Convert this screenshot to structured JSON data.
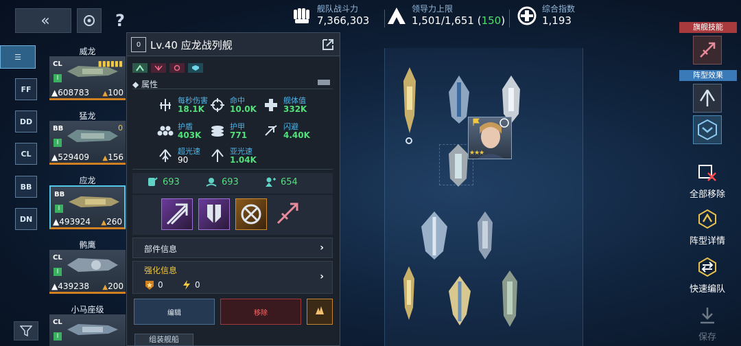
{
  "header": {
    "back_label": "«",
    "help_label": "?",
    "stats": [
      {
        "label": "舰队战斗力",
        "value": "7,366,303",
        "icon": "fist-icon"
      },
      {
        "label": "领导力上限",
        "value_main": "1,501/1,651 (",
        "value_green": "150",
        "value_end": ")",
        "icon": "leadership-icon"
      },
      {
        "label": "综合指数",
        "value": "1,193",
        "icon": "index-icon"
      }
    ]
  },
  "class_filters": [
    {
      "label": "☰",
      "active": true
    },
    {
      "label": "FF",
      "active": false
    },
    {
      "label": "DD",
      "active": false
    },
    {
      "label": "CL",
      "active": false
    },
    {
      "label": "BB",
      "active": false
    },
    {
      "label": "DN",
      "active": false
    }
  ],
  "ships": [
    {
      "name": "威龙",
      "class": "CL",
      "tier": "I",
      "power": "608783",
      "lead": "100",
      "extra": "▮▮▮▮▮▮"
    },
    {
      "name": "猛龙",
      "class": "BB",
      "tier": "I",
      "power": "529409",
      "lead": "156",
      "extra": "0"
    },
    {
      "name": "应龙",
      "class": "BB",
      "tier": "I",
      "power": "493924",
      "lead": "260",
      "extra": ""
    },
    {
      "name": "鹘鹰",
      "class": "CL",
      "tier": "I",
      "power": "439238",
      "lead": "200",
      "extra": ""
    },
    {
      "name": "小马座级",
      "class": "CL",
      "tier": "I",
      "power": "",
      "lead": "",
      "extra": ""
    }
  ],
  "panel": {
    "level_box": "0",
    "title": "Lv.40 应龙战列舰",
    "section_title": "◆ 属性",
    "attributes": [
      {
        "name": "每秒伤害",
        "value": "18.1K",
        "icon": "dps-icon"
      },
      {
        "name": "命中",
        "value": "10.0K",
        "icon": "crosshair-icon"
      },
      {
        "name": "舰体值",
        "value": "332K",
        "icon": "hull-icon"
      },
      {
        "name": "护盾",
        "value": "403K",
        "icon": "shield-hex-icon"
      },
      {
        "name": "护甲",
        "value": "771",
        "icon": "armor-icon"
      },
      {
        "name": "闪避",
        "value": "4.40K",
        "icon": "evade-icon"
      },
      {
        "name": "超光速",
        "value": "90",
        "icon": "ftl-icon"
      },
      {
        "name": "亚光速",
        "value": "1.04K",
        "icon": "sublight-icon"
      }
    ],
    "skill_values": [
      "693",
      "693",
      "654"
    ],
    "parts_label": "部件信息",
    "enhance_label": "强化信息",
    "enhance_values": [
      "0",
      "0"
    ],
    "edit_label": "编辑",
    "remove_label": "移除",
    "below_label": "组装舰船"
  },
  "right_sidebar": {
    "flagship_skill": "旗舰技能",
    "formation_effect": "阵型效果",
    "remove_all": "全部移除",
    "formation_detail": "阵型详情",
    "quick_edit": "快速编队",
    "save": "保存"
  },
  "colors": {
    "accent_green": "#52e07a",
    "accent_blue": "#4fb4e8",
    "remove_red": "#ff6a6a",
    "orange_bar": "#d08020"
  }
}
